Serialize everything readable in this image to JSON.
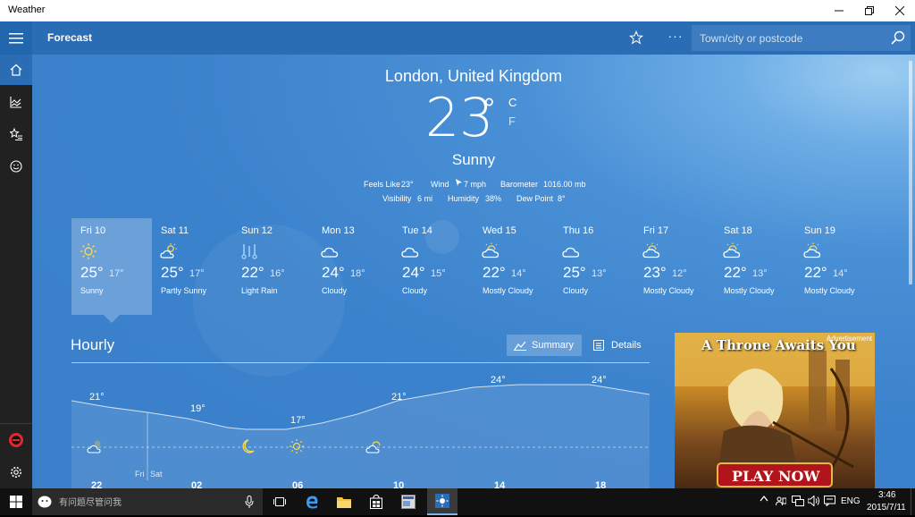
{
  "window": {
    "title": "Weather"
  },
  "appbar": {
    "section": "Forecast",
    "more": "···",
    "search_placeholder": "Town/city or postcode"
  },
  "current": {
    "location": "London, United Kingdom",
    "temperature": "23",
    "degree": "°",
    "unit_c": "C",
    "unit_f": "F",
    "condition": "Sunny",
    "feels_like_label": "Feels Like",
    "feels_like": "23°",
    "wind_label": "Wind",
    "wind": "7 mph",
    "barometer_label": "Barometer",
    "barometer": "1016.00 mb",
    "visibility_label": "Visibility",
    "visibility": "6 mi",
    "humidity_label": "Humidity",
    "humidity": "38%",
    "dew_point_label": "Dew Point",
    "dew_point": "8°"
  },
  "forecast": [
    {
      "day": "Fri 10",
      "hi": "25°",
      "lo": "17°",
      "condition": "Sunny",
      "icon": "sun-icon"
    },
    {
      "day": "Sat 11",
      "hi": "25°",
      "lo": "17°",
      "condition": "Partly Sunny",
      "icon": "partly-sunny-icon"
    },
    {
      "day": "Sun 12",
      "hi": "22°",
      "lo": "16°",
      "condition": "Light Rain",
      "icon": "rain-icon"
    },
    {
      "day": "Mon 13",
      "hi": "24°",
      "lo": "18°",
      "condition": "Cloudy",
      "icon": "cloud-icon"
    },
    {
      "day": "Tue 14",
      "hi": "24°",
      "lo": "15°",
      "condition": "Cloudy",
      "icon": "cloud-icon"
    },
    {
      "day": "Wed 15",
      "hi": "22°",
      "lo": "14°",
      "condition": "Mostly Cloudy",
      "icon": "mostly-cloudy-icon"
    },
    {
      "day": "Thu 16",
      "hi": "25°",
      "lo": "13°",
      "condition": "Cloudy",
      "icon": "cloud-icon"
    },
    {
      "day": "Fri 17",
      "hi": "23°",
      "lo": "12°",
      "condition": "Mostly Cloudy",
      "icon": "mostly-cloudy-icon"
    },
    {
      "day": "Sat 18",
      "hi": "22°",
      "lo": "13°",
      "condition": "Mostly Cloudy",
      "icon": "mostly-cloudy-icon"
    },
    {
      "day": "Sun 19",
      "hi": "22°",
      "lo": "14°",
      "condition": "Mostly Cloudy",
      "icon": "mostly-cloudy-icon"
    }
  ],
  "hourly": {
    "title": "Hourly",
    "summary_label": "Summary",
    "details_label": "Details",
    "temps": [
      "21°",
      "19°",
      "17°",
      "21°",
      "24°",
      "24°"
    ],
    "hours": [
      "22",
      "02",
      "06",
      "10",
      "14",
      "18"
    ],
    "day_markers": [
      "Fri",
      "Sat"
    ]
  },
  "ad": {
    "label": "Advertisement",
    "headline": "A Throne Awaits You",
    "cta": "PLAY NOW"
  },
  "taskbar": {
    "search_placeholder": "有问题尽管问我",
    "time": "3:46",
    "date": "2015/7/11",
    "language": "ENG"
  },
  "colors": {
    "accent": "#2a6db5",
    "sidebar": "#212121",
    "taskbar": "#111111"
  }
}
